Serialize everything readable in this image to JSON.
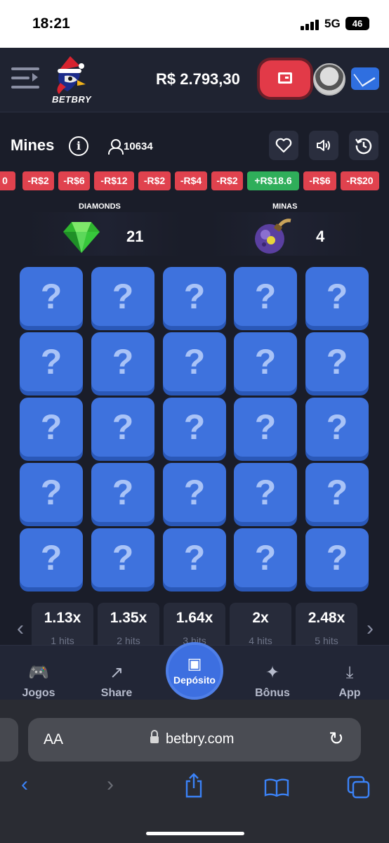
{
  "status_bar": {
    "time": "18:21",
    "network": "5G",
    "battery": "46"
  },
  "header": {
    "logo_text": "BETBRY",
    "balance": "R$ 2.793,30"
  },
  "game": {
    "title": "Mines",
    "players": "10634"
  },
  "recent_results": [
    "0",
    "-R$2",
    "-R$6",
    "-R$12",
    "-R$2",
    "-R$4",
    "-R$2",
    "+R$18.6",
    "-R$6",
    "-R$20"
  ],
  "stats": {
    "diamonds": {
      "label": "DIAMONDS",
      "value": "21"
    },
    "mines": {
      "label": "MINAS",
      "value": "4"
    }
  },
  "tile_symbol": "?",
  "multipliers": [
    {
      "value": "1.13x",
      "label": "1 hits"
    },
    {
      "value": "1.35x",
      "label": "2 hits"
    },
    {
      "value": "1.64x",
      "label": "3 hits"
    },
    {
      "value": "2x",
      "label": "4 hits"
    },
    {
      "value": "2.48x",
      "label": "5 hits"
    }
  ],
  "bottom_nav": {
    "games": "Jogos",
    "share": "Share",
    "deposit": "Depósito",
    "bonus": "Bônus",
    "app": "App"
  },
  "browser": {
    "text_size": "AA",
    "url": "betbry.com"
  },
  "colors": {
    "tile": "#3e72dd",
    "loss_chip": "#e0424e",
    "win_chip": "#2fae5a",
    "accent": "#3d6fe0"
  }
}
